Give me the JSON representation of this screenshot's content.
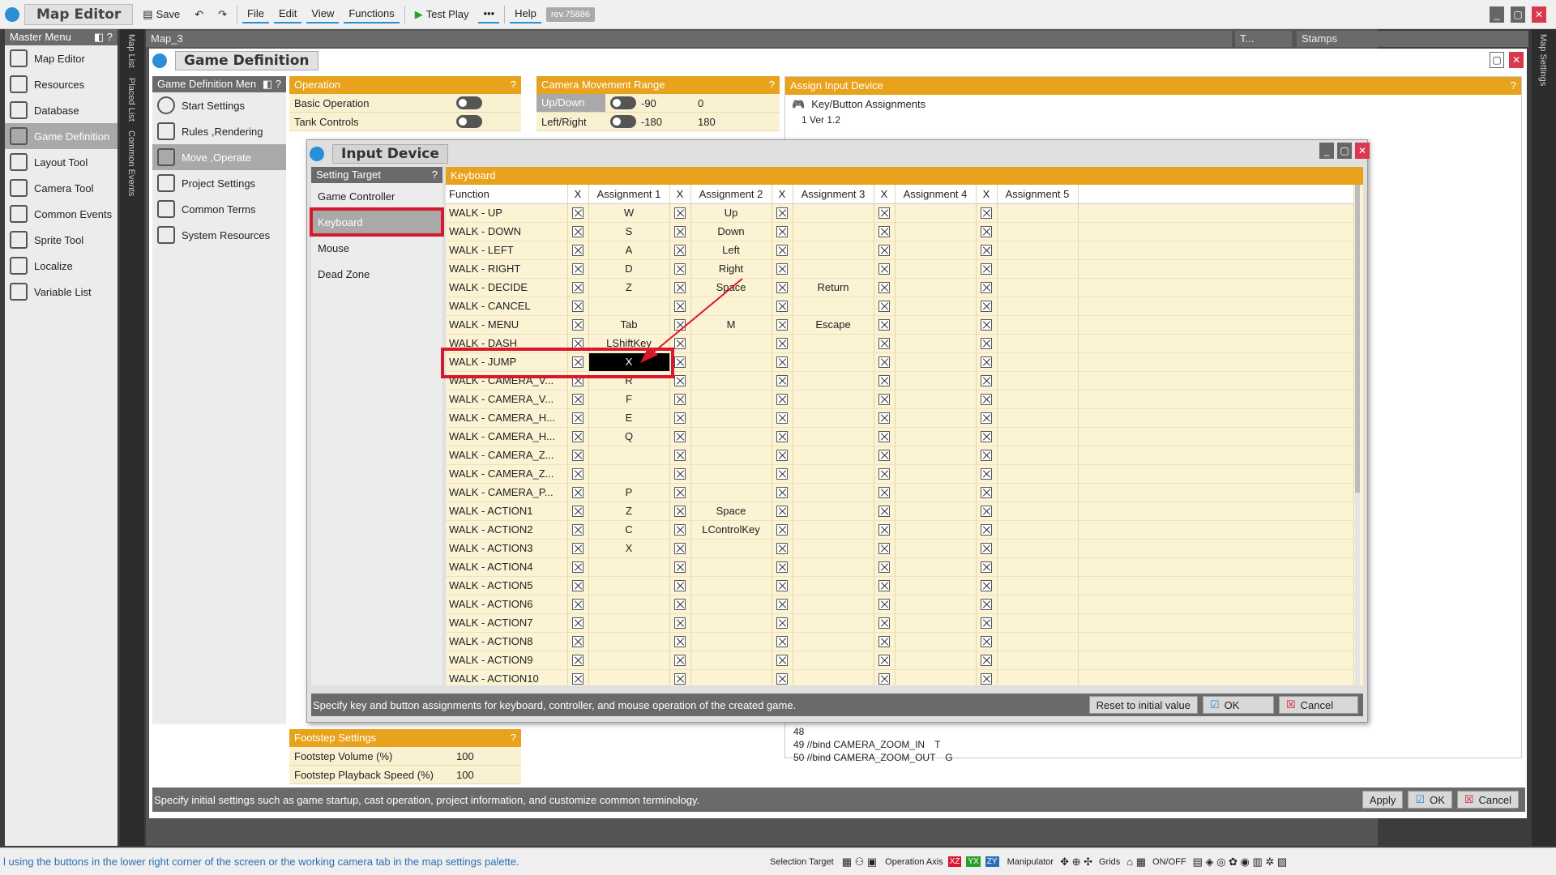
{
  "app": {
    "title": "Map Editor",
    "revision": "rev.75886"
  },
  "toolbar": {
    "save": "Save",
    "menus": [
      "File",
      "Edit",
      "View",
      "Functions"
    ],
    "test_play": "Test Play",
    "help": "Help"
  },
  "master_menu": {
    "title": "Master Menu",
    "items": [
      "Map Editor",
      "Resources",
      "Database",
      "Game Definition",
      "Layout Tool",
      "Camera Tool",
      "Common Events",
      "Sprite Tool",
      "Localize",
      "Variable List"
    ],
    "active": "Game Definition"
  },
  "vertical_tabs": [
    "Map List",
    "Placed List",
    "Common Events"
  ],
  "right_vertical_tab": "Map Settings",
  "map_tab": "Map_3",
  "stamps": {
    "short_tab": "T...",
    "title": "Stamps"
  },
  "game_definition": {
    "title": "Game Definition",
    "menu_title": "Game Definition Men",
    "menu_items": [
      "Start Settings",
      "Rules ,Rendering",
      "Move ,Operate",
      "Project Settings",
      "Common Terms",
      "System Resources"
    ],
    "active": "Move ,Operate",
    "status": "Specify initial settings such as game startup, cast operation, project information, and customize common terminology.",
    "apply": "Apply",
    "ok": "OK",
    "cancel": "Cancel"
  },
  "operation": {
    "title": "Operation",
    "rows": [
      {
        "label": "Basic Operation"
      },
      {
        "label": "Tank Controls"
      }
    ]
  },
  "camera_range": {
    "title": "Camera Movement Range",
    "rows": [
      {
        "label": "Up/Down",
        "min": "-90",
        "max": "0"
      },
      {
        "label": "Left/Right",
        "min": "-180",
        "max": "180"
      }
    ]
  },
  "assign_input": {
    "title": "Assign Input Device",
    "subtitle": "Key/Button Assignments",
    "code_top": [
      {
        "num": "1",
        "text": "Ver 1.2"
      }
    ],
    "code_bottom": [
      {
        "num": "48",
        "text": ""
      },
      {
        "num": "49",
        "text": "//bind CAMERA_ZOOM_IN　T"
      },
      {
        "num": "50",
        "text": "//bind CAMERA_ZOOM_OUT　G"
      }
    ]
  },
  "footstep": {
    "title": "Footstep Settings",
    "rows": [
      {
        "label": "Footstep Volume (%)",
        "value": "100"
      },
      {
        "label": "Footstep Playback Speed (%)",
        "value": "100"
      }
    ]
  },
  "input_device": {
    "title": "Input Device",
    "setting_target_title": "Setting Target",
    "targets": [
      "Game Controller",
      "Keyboard",
      "Mouse",
      "Dead Zone"
    ],
    "active_target": "Keyboard",
    "keyboard_title": "Keyboard",
    "columns": [
      "Function",
      "X",
      "Assignment 1",
      "X",
      "Assignment 2",
      "X",
      "Assignment 3",
      "X",
      "Assignment 4",
      "X",
      "Assignment 5"
    ],
    "rows": [
      {
        "fn": "WALK - UP",
        "a": [
          "W",
          "Up",
          "",
          "",
          ""
        ]
      },
      {
        "fn": "WALK - DOWN",
        "a": [
          "S",
          "Down",
          "",
          "",
          ""
        ]
      },
      {
        "fn": "WALK - LEFT",
        "a": [
          "A",
          "Left",
          "",
          "",
          ""
        ]
      },
      {
        "fn": "WALK - RIGHT",
        "a": [
          "D",
          "Right",
          "",
          "",
          ""
        ]
      },
      {
        "fn": "WALK - DECIDE",
        "a": [
          "Z",
          "Space",
          "Return",
          "",
          ""
        ]
      },
      {
        "fn": "WALK - CANCEL",
        "a": [
          "",
          "",
          "",
          "",
          ""
        ]
      },
      {
        "fn": "WALK - MENU",
        "a": [
          "Tab",
          "M",
          "Escape",
          "",
          ""
        ]
      },
      {
        "fn": "WALK - DASH",
        "a": [
          "LShiftKey",
          "",
          "",
          "",
          ""
        ]
      },
      {
        "fn": "WALK - JUMP",
        "a": [
          "X",
          "",
          "",
          "",
          ""
        ]
      },
      {
        "fn": "WALK - CAMERA_V...",
        "a": [
          "R",
          "",
          "",
          "",
          ""
        ]
      },
      {
        "fn": "WALK - CAMERA_V...",
        "a": [
          "F",
          "",
          "",
          "",
          ""
        ]
      },
      {
        "fn": "WALK - CAMERA_H...",
        "a": [
          "E",
          "",
          "",
          "",
          ""
        ]
      },
      {
        "fn": "WALK - CAMERA_H...",
        "a": [
          "Q",
          "",
          "",
          "",
          ""
        ]
      },
      {
        "fn": "WALK - CAMERA_Z...",
        "a": [
          "",
          "",
          "",
          "",
          ""
        ]
      },
      {
        "fn": "WALK - CAMERA_Z...",
        "a": [
          "",
          "",
          "",
          "",
          ""
        ]
      },
      {
        "fn": "WALK - CAMERA_P...",
        "a": [
          "P",
          "",
          "",
          "",
          ""
        ]
      },
      {
        "fn": "WALK - ACTION1",
        "a": [
          "Z",
          "Space",
          "",
          "",
          ""
        ]
      },
      {
        "fn": "WALK - ACTION2",
        "a": [
          "C",
          "LControlKey",
          "",
          "",
          ""
        ]
      },
      {
        "fn": "WALK - ACTION3",
        "a": [
          "X",
          "",
          "",
          "",
          ""
        ]
      },
      {
        "fn": "WALK - ACTION4",
        "a": [
          "",
          "",
          "",
          "",
          ""
        ]
      },
      {
        "fn": "WALK - ACTION5",
        "a": [
          "",
          "",
          "",
          "",
          ""
        ]
      },
      {
        "fn": "WALK - ACTION6",
        "a": [
          "",
          "",
          "",
          "",
          ""
        ]
      },
      {
        "fn": "WALK - ACTION7",
        "a": [
          "",
          "",
          "",
          "",
          ""
        ]
      },
      {
        "fn": "WALK - ACTION8",
        "a": [
          "",
          "",
          "",
          "",
          ""
        ]
      },
      {
        "fn": "WALK - ACTION9",
        "a": [
          "",
          "",
          "",
          "",
          ""
        ]
      },
      {
        "fn": "WALK - ACTION10",
        "a": [
          "",
          "",
          "",
          "",
          ""
        ]
      }
    ],
    "selected_row": 8,
    "status": "Specify key and button assignments for keyboard, controller, and mouse operation of the created game.",
    "reset": "Reset to initial value",
    "ok": "OK",
    "cancel": "Cancel"
  },
  "bottom_bar": {
    "hint": "l using the buttons in the lower right corner of the screen or the working camera tab in the map settings palette.",
    "labels": [
      "Selection Target",
      "Operation Axis",
      "Manipulator",
      "Grids",
      "ON/OFF"
    ],
    "axes": [
      "XZ",
      "YX",
      "ZY"
    ]
  },
  "colors": {
    "accent": "#2a8fd6",
    "section": "#e8a21c",
    "highlight": "#d8182e",
    "row_bg": "#fbf3d4"
  }
}
